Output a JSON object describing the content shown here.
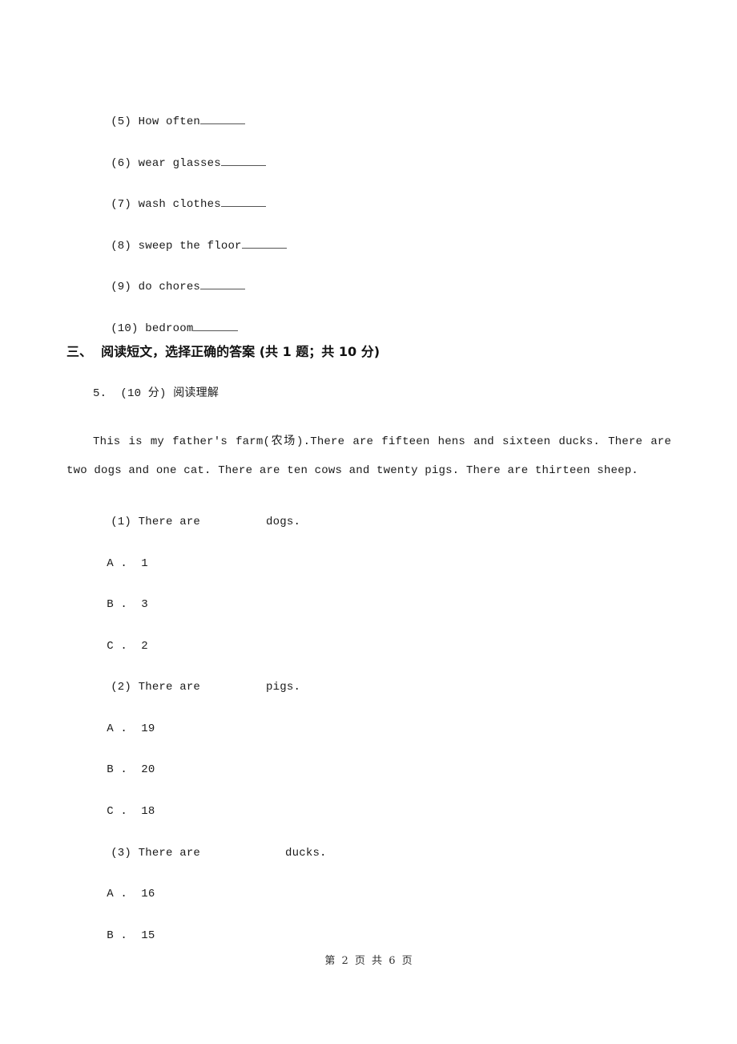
{
  "vocab_items": [
    {
      "num": "(5)",
      "text": "How often"
    },
    {
      "num": "(6)",
      "text": "wear glasses"
    },
    {
      "num": "(7)",
      "text": "wash clothes"
    },
    {
      "num": "(8)",
      "text": "sweep the floor"
    },
    {
      "num": "(9)",
      "text": "do chores"
    },
    {
      "num": "(10)",
      "text": "bedroom"
    }
  ],
  "section": {
    "heading": "三、  阅读短文，选择正确的答案 (共 1 题；共 10 分)"
  },
  "question": {
    "head": "5.  (10 分) 阅读理解",
    "passage": "This is my father's farm(农场).There are fifteen hens and sixteen ducks. There are two dogs and one cat. There are ten cows and twenty pigs. There are thirteen sheep.",
    "subquestions": [
      {
        "num": "(1)",
        "prefix": "There are",
        "suffix": "dogs.",
        "options": [
          {
            "letter": "A",
            "text": "1"
          },
          {
            "letter": "B",
            "text": "3"
          },
          {
            "letter": "C",
            "text": "2"
          }
        ]
      },
      {
        "num": "(2)",
        "prefix": "There are",
        "suffix": "pigs.",
        "options": [
          {
            "letter": "A",
            "text": "19"
          },
          {
            "letter": "B",
            "text": "20"
          },
          {
            "letter": "C",
            "text": "18"
          }
        ]
      },
      {
        "num": "(3)",
        "prefix": "There are",
        "suffix": "ducks.",
        "options": [
          {
            "letter": "A",
            "text": "16"
          },
          {
            "letter": "B",
            "text": "15"
          }
        ]
      }
    ]
  },
  "footer": {
    "page_label": "第 2 页 共 6 页"
  }
}
